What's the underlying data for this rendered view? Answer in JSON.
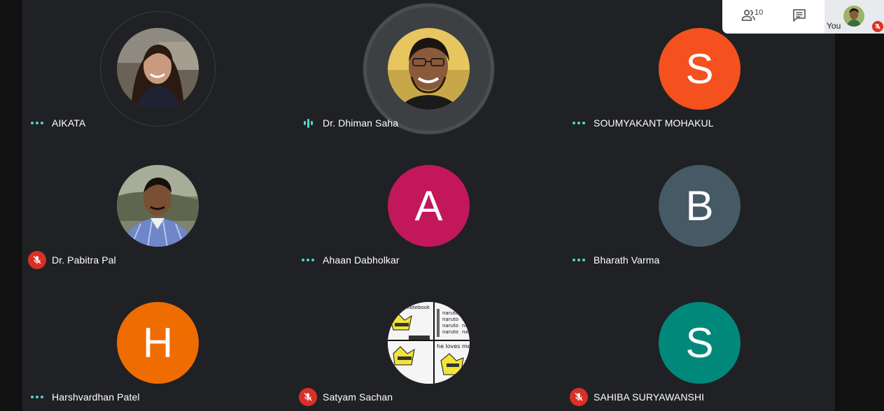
{
  "participants_panel": {
    "count": "10",
    "people_icon": "people-icon",
    "chat_icon": "chat-icon",
    "self_label": "You",
    "self_mic": "mic-off-icon"
  },
  "tiles": [
    {
      "name": "AIKATA",
      "status": "dots",
      "avatar": "photo"
    },
    {
      "name": "Dr. Dhiman Saha",
      "status": "speaking",
      "avatar": "photo"
    },
    {
      "name": "SOUMYAKANT MOHAKUL",
      "status": "dots",
      "avatar_letter": "S",
      "avatar_color": "#f4511e"
    },
    {
      "name": "Dr. Pabitra Pal",
      "status": "muted",
      "avatar": "photo"
    },
    {
      "name": "Ahaan Dabholkar",
      "status": "dots",
      "avatar_letter": "A",
      "avatar_color": "#c2185b"
    },
    {
      "name": "Bharath Varma",
      "status": "dots",
      "avatar_letter": "B",
      "avatar_color": "#455a64"
    },
    {
      "name": "Harshvardhan Patel",
      "status": "dots",
      "avatar_letter": "H",
      "avatar_color": "#ef6c00"
    },
    {
      "name": "Satyam Sachan",
      "status": "muted",
      "avatar": "comic"
    },
    {
      "name": "SAHIBA SURYAWANSHI",
      "status": "muted",
      "avatar_letter": "S",
      "avatar_color": "#00897b"
    }
  ],
  "comic_text": [
    "t his notebook",
    "naruto",
    "naruto",
    "naruto",
    "naruto",
    "na",
    "na",
    "na",
    "he loves me"
  ]
}
